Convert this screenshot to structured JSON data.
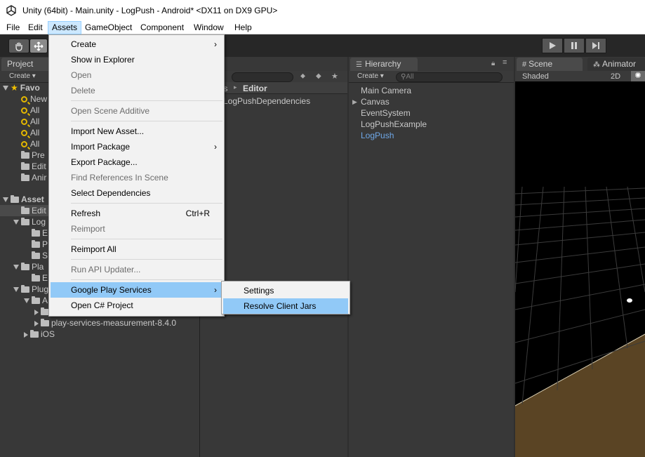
{
  "window": {
    "title": "Unity (64bit) - Main.unity - LogPush - Android* <DX11 on DX9 GPU>"
  },
  "menubar": [
    "File",
    "Edit",
    "Assets",
    "GameObject",
    "Component",
    "Window",
    "Help"
  ],
  "project": {
    "tab": "Project",
    "create": "Create",
    "breadcrumb": {
      "prefix": "ts",
      "current": "Editor"
    },
    "content_item": "LogPushDependencies",
    "tree": [
      {
        "label": "Favo",
        "level": 0,
        "kind": "star",
        "fold": "open"
      },
      {
        "label": "New",
        "level": 1,
        "kind": "search"
      },
      {
        "label": "All",
        "level": 1,
        "kind": "search"
      },
      {
        "label": "All",
        "level": 1,
        "kind": "search"
      },
      {
        "label": "All",
        "level": 1,
        "kind": "search"
      },
      {
        "label": "All",
        "level": 1,
        "kind": "search"
      },
      {
        "label": "Pre",
        "level": 1,
        "kind": "folder"
      },
      {
        "label": "Edit",
        "level": 1,
        "kind": "folder"
      },
      {
        "label": "Anir",
        "level": 1,
        "kind": "folder"
      },
      {
        "label": "",
        "level": 0,
        "kind": "gap"
      },
      {
        "label": "Asset",
        "level": 0,
        "kind": "folder",
        "fold": "open"
      },
      {
        "label": "Edit",
        "level": 1,
        "kind": "folder",
        "selected": true
      },
      {
        "label": "Log",
        "level": 1,
        "kind": "folder",
        "fold": "open"
      },
      {
        "label": "E",
        "level": 2,
        "kind": "folder"
      },
      {
        "label": "P",
        "level": 2,
        "kind": "folder"
      },
      {
        "label": "S",
        "level": 2,
        "kind": "folder"
      },
      {
        "label": "Pla",
        "level": 1,
        "kind": "folder",
        "fold": "open"
      },
      {
        "label": "E",
        "level": 2,
        "kind": "folder"
      },
      {
        "label": "Plug",
        "level": 1,
        "kind": "folder",
        "fold": "open"
      },
      {
        "label": "A",
        "level": 2,
        "kind": "folder",
        "fold": "open"
      },
      {
        "label": "",
        "level": 3,
        "kind": "folder",
        "fold": "closed"
      },
      {
        "label": "play-services-measurement-8.4.0",
        "level": 3,
        "kind": "folder",
        "fold": "closed"
      },
      {
        "label": "iOS",
        "level": 2,
        "kind": "folder",
        "fold": "closed"
      }
    ]
  },
  "hierarchy": {
    "tab": "Hierarchy",
    "create": "Create",
    "search_placeholder": "All",
    "items": [
      {
        "label": "Main Camera",
        "fold": false,
        "prefab": false
      },
      {
        "label": "Canvas",
        "fold": true,
        "prefab": false
      },
      {
        "label": "EventSystem",
        "fold": false,
        "prefab": false
      },
      {
        "label": "LogPushExample",
        "fold": false,
        "prefab": false
      },
      {
        "label": "LogPush",
        "fold": false,
        "prefab": true
      }
    ]
  },
  "scene": {
    "tab": "Scene",
    "animator_tab": "Animator",
    "shading": "Shaded",
    "mode_2d": "2D"
  },
  "assets_menu": {
    "items": [
      {
        "label": "Create",
        "submenu": true
      },
      {
        "label": "Show in Explorer"
      },
      {
        "label": "Open",
        "disabled": true
      },
      {
        "label": "Delete",
        "disabled": true
      },
      {
        "sep": true
      },
      {
        "label": "Open Scene Additive",
        "disabled": true
      },
      {
        "sep": true
      },
      {
        "label": "Import New Asset..."
      },
      {
        "label": "Import Package",
        "submenu": true
      },
      {
        "label": "Export Package..."
      },
      {
        "label": "Find References In Scene",
        "disabled": true
      },
      {
        "label": "Select Dependencies"
      },
      {
        "sep": true
      },
      {
        "label": "Refresh",
        "shortcut": "Ctrl+R"
      },
      {
        "label": "Reimport",
        "disabled": true
      },
      {
        "sep": true
      },
      {
        "label": "Reimport All"
      },
      {
        "sep": true
      },
      {
        "label": "Run API Updater...",
        "disabled": true
      },
      {
        "sep": true
      },
      {
        "label": "Google Play Services",
        "submenu": true,
        "highlighted": true
      },
      {
        "label": "Open C# Project"
      }
    ]
  },
  "gps_submenu": {
    "items": [
      {
        "label": "Settings"
      },
      {
        "label": "Resolve Client Jars",
        "highlighted": true
      }
    ]
  }
}
